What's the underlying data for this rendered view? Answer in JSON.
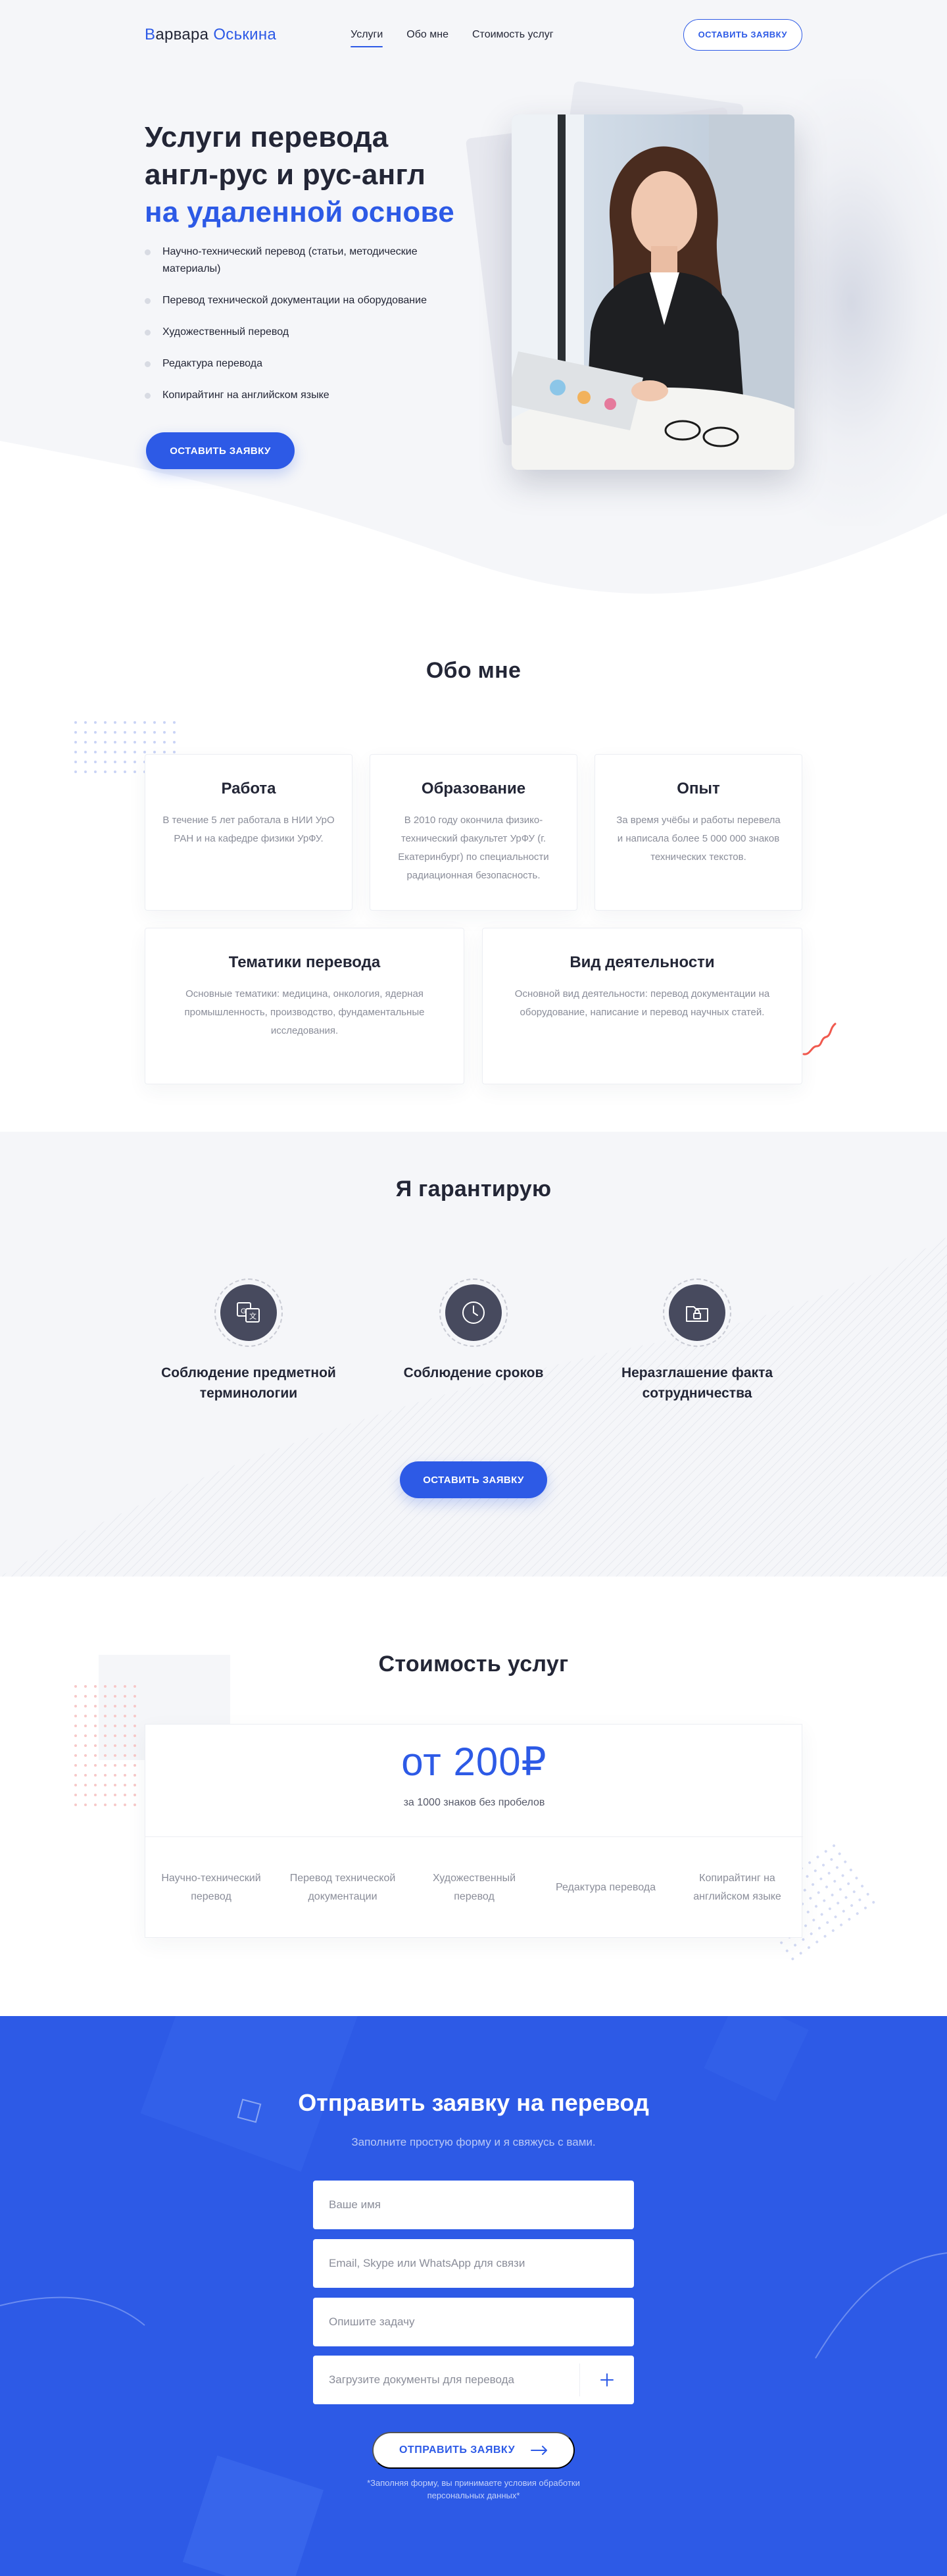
{
  "header": {
    "logo_first": "В",
    "logo_rest": "арвара",
    "logo_last": "Оськина",
    "nav": [
      {
        "label": "Услуги"
      },
      {
        "label": "Обо мне"
      },
      {
        "label": "Стоимость услуг"
      }
    ],
    "cta_label": "ОСТАВИТЬ ЗАЯВКУ"
  },
  "hero": {
    "title_line1": "Услуги перевода",
    "title_line2": "англ-рус и рус-англ",
    "title_line3": "на удаленной основе",
    "services": [
      "Научно-технический перевод (статьи, методические материалы)",
      "Перевод технической документации на оборудование",
      "Художественный перевод",
      "Редактура перевода",
      "Копирайтинг на английском языке"
    ],
    "cta_label": "ОСТАВИТЬ ЗАЯВКУ"
  },
  "about": {
    "title": "Обо мне",
    "cards": [
      {
        "title": "Работа",
        "text": "В течение 5 лет работала в НИИ УрО РАН и на кафедре физики УрФУ."
      },
      {
        "title": "Образование",
        "text": "В 2010 году окончила физико-технический факультет УрФУ (г. Екатеринбург) по специальности радиационная безопасность."
      },
      {
        "title": "Опыт",
        "text": "За время учёбы и работы перевела и написала более 5 000 000 знаков технических текстов."
      },
      {
        "title": "Тематики перевода",
        "text": "Основные тематики: медицина, онкология, ядерная промышленность, производство, фундаментальные исследования."
      },
      {
        "title": "Вид деятельности",
        "text": "Основной вид деятельности: перевод документации на оборудование, написание и перевод научных статей."
      }
    ]
  },
  "guarantee": {
    "title": "Я гарантирую",
    "items": [
      {
        "label": "Соблюдение предметной терминологии",
        "icon": "translate-icon"
      },
      {
        "label": "Соблюдение сроков",
        "icon": "clock-icon"
      },
      {
        "label": "Неразглашение факта сотрудничества",
        "icon": "lock-folder-icon"
      }
    ],
    "cta_label": "ОСТАВИТЬ ЗАЯВКУ"
  },
  "pricing": {
    "title": "Стоимость услуг",
    "price": "от 200₽",
    "unit": "за 1000 знаков без пробелов",
    "services": [
      "Научно-технический перевод",
      "Перевод технической документации",
      "Художественный перевод",
      "Редактура перевода",
      "Копирайтинг на английском языке"
    ]
  },
  "form": {
    "title": "Отправить заявку на перевод",
    "subtitle": "Заполните простую форму и я свяжусь с вами.",
    "name_placeholder": "Ваше имя",
    "contact_placeholder": "Email, Skype или WhatsApp для связи",
    "task_placeholder": "Опишите задачу",
    "upload_label": "Загрузите документы для перевода",
    "submit_label": "ОТПРАВИТЬ ЗАЯВКУ",
    "disclaimer": "*Заполняя форму, вы принимаете условия обработки персональных данных*"
  },
  "colors": {
    "accent": "#2d5ae6",
    "text": "#232636",
    "muted": "#8a8d99",
    "light_bg": "#f5f6f9"
  }
}
